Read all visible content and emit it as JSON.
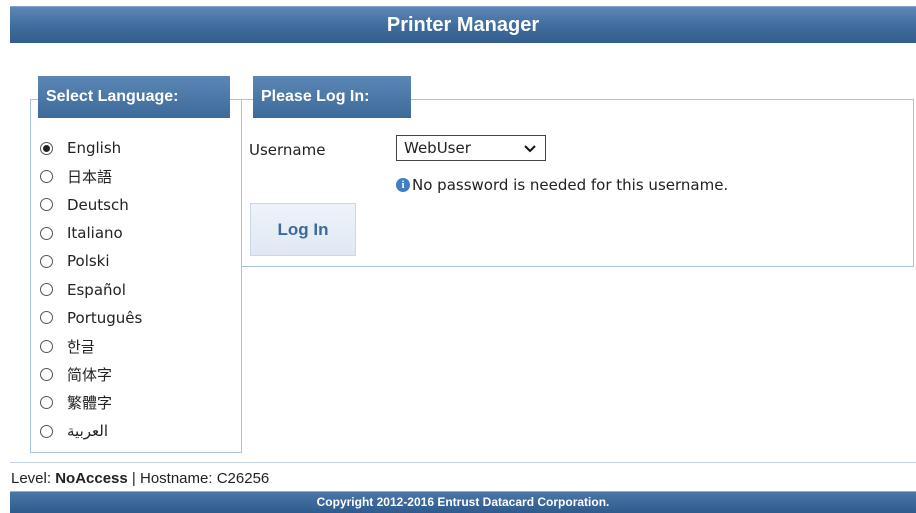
{
  "app": {
    "title": "Printer Manager"
  },
  "language_panel": {
    "legend": "Select Language:",
    "selected_index": 0,
    "languages": [
      {
        "label": "English",
        "checked": true
      },
      {
        "label": "日本語",
        "checked": false
      },
      {
        "label": "Deutsch",
        "checked": false
      },
      {
        "label": "Italiano",
        "checked": false
      },
      {
        "label": "Polski",
        "checked": false
      },
      {
        "label": "Español",
        "checked": false
      },
      {
        "label": "Português",
        "checked": false
      },
      {
        "label": "한글",
        "checked": false
      },
      {
        "label": "简体字",
        "checked": false
      },
      {
        "label": "繁體字",
        "checked": false
      },
      {
        "label": "العربية",
        "checked": false
      }
    ]
  },
  "login_panel": {
    "legend": "Please Log In:",
    "username_label": "Username",
    "username_value": "WebUser",
    "info_text": "No password is needed for this username.",
    "login_button": "Log In"
  },
  "status": {
    "level_label": "Level:",
    "level_value": "NoAccess",
    "separator": "|",
    "hostname_label": "Hostname:",
    "hostname_value": "C26256"
  },
  "footer": {
    "copyright": "Copyright 2012-2016 Entrust Datacard Corporation."
  },
  "colors": {
    "header": "#3f6b9d",
    "legend": "#4a76a8",
    "button_text": "#3d6b99"
  }
}
